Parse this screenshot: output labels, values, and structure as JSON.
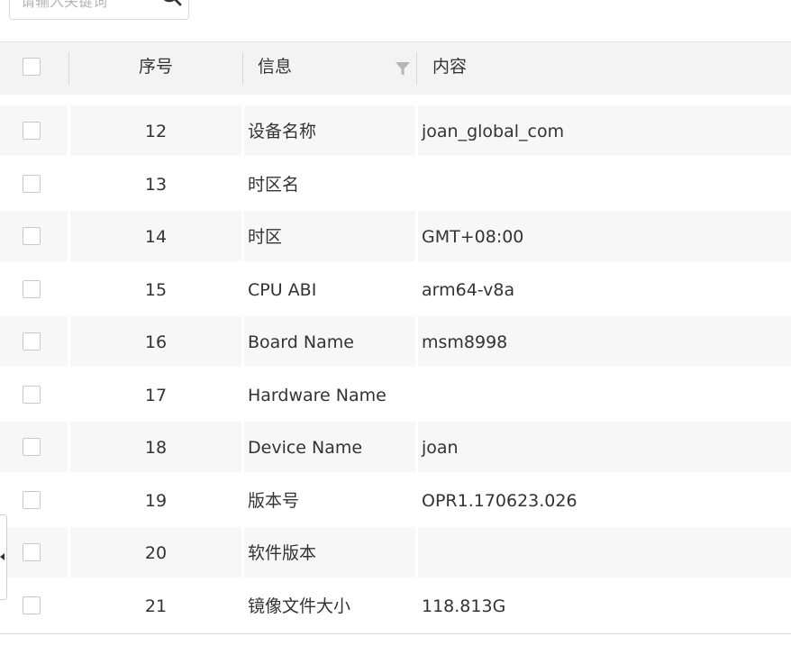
{
  "search": {
    "placeholder": "请输入关键词"
  },
  "table": {
    "columns": {
      "index": "序号",
      "info": "信息",
      "content": "内容"
    },
    "rows": [
      {
        "index": "12",
        "info": "设备名称",
        "content": "joan_global_com"
      },
      {
        "index": "13",
        "info": "时区名",
        "content": ""
      },
      {
        "index": "14",
        "info": "时区",
        "content": "GMT+08:00"
      },
      {
        "index": "15",
        "info": "CPU ABI",
        "content": "arm64-v8a"
      },
      {
        "index": "16",
        "info": "Board Name",
        "content": "msm8998"
      },
      {
        "index": "17",
        "info": "Hardware Name",
        "content": ""
      },
      {
        "index": "18",
        "info": "Device Name",
        "content": "joan"
      },
      {
        "index": "19",
        "info": "版本号",
        "content": "OPR1.170623.026"
      },
      {
        "index": "20",
        "info": "软件版本",
        "content": ""
      },
      {
        "index": "21",
        "info": "镜像文件大小",
        "content": "118.813G"
      }
    ]
  },
  "icons": {
    "search": "search-icon",
    "filter": "filter-icon",
    "collapse": "collapse-arrow-icon"
  },
  "colors": {
    "header_bg": "#f3f3f3",
    "row_alt_bg": "#f7f7f7",
    "checkbox_border": "#c3c8d2",
    "text": "#333333"
  }
}
